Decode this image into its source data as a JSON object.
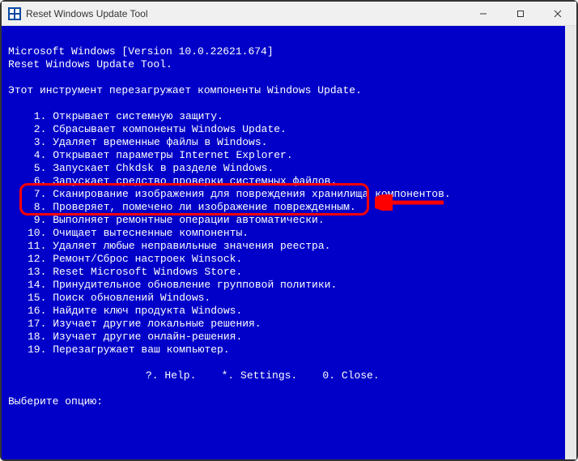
{
  "window": {
    "title": "Reset Windows Update Tool"
  },
  "console": {
    "header1": "Microsoft Windows [Version 10.0.22621.674]",
    "header2": "Reset Windows Update Tool.",
    "intro": "Этот инструмент перезагружает компоненты Windows Update.",
    "items": [
      "Открывает системную защиту.",
      "Сбрасывает компоненты Windows Update.",
      "Удаляет временные файлы в Windows.",
      "Открывает параметры Internet Explorer.",
      "Запускает Chkdsk в разделе Windows.",
      "Запускает средство проверки системных файлов.",
      "Cканирование изображения для повреждения хранилища компонентов.",
      "Проверяет, помечено ли изображение поврежденным.",
      "Выполняет ремонтные операции автоматически.",
      "Очищает вытесненные компоненты.",
      "Удаляет любые неправильные значения реестра.",
      "Ремонт/Сброс настроек Winsock.",
      "Reset Microsoft Windows Store.",
      "Принудительное обновление групповой политики.",
      "Поиск обновлений Windows.",
      "Найдите ключ продукта Windows.",
      "Изучает другие локальные решения.",
      "Изучает другие онлайн-решения.",
      "Перезагружает ваш компьютер."
    ],
    "footer": "?. Help.    *. Settings.    0. Close.",
    "prompt": "Выберите опцию:"
  },
  "highlight": {
    "start": 5,
    "end": 6
  }
}
